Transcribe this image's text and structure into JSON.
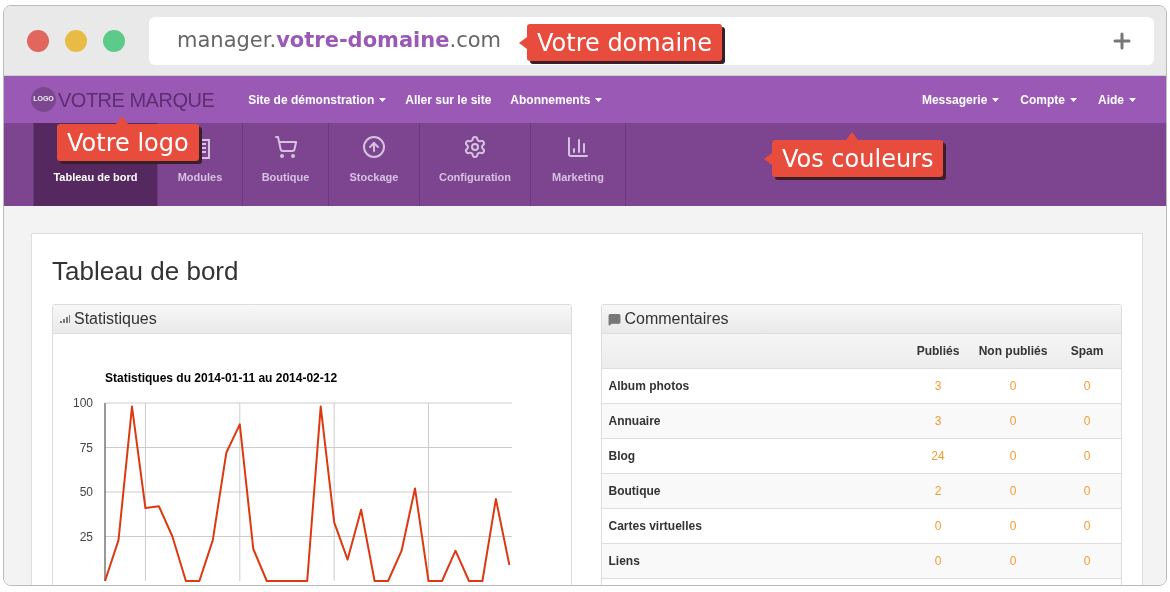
{
  "browser": {
    "url": [
      {
        "text": "manager.",
        "highlight": false
      },
      {
        "text": "votre-domaine",
        "highlight": true
      },
      {
        "text": ".com",
        "highlight": false
      }
    ]
  },
  "navbar": {
    "logo_badge": "LOGO",
    "brand": "VOTRE MARQUE",
    "menus_left": [
      {
        "label": "Site de démonstration",
        "dropdown": true
      },
      {
        "label": "Aller sur le site",
        "dropdown": false
      },
      {
        "label": "Abonnements",
        "dropdown": true
      }
    ],
    "menus_right": [
      {
        "label": "Messagerie",
        "dropdown": true
      },
      {
        "label": "Compte",
        "dropdown": true
      },
      {
        "label": "Aide",
        "dropdown": true
      }
    ]
  },
  "tabs": [
    {
      "label": "Tableau de bord",
      "selected": true
    },
    {
      "label": "Modules",
      "selected": false
    },
    {
      "label": "Boutique",
      "selected": false
    },
    {
      "label": "Stockage",
      "selected": false
    },
    {
      "label": "Configuration",
      "selected": false
    },
    {
      "label": "Marketing",
      "selected": false
    }
  ],
  "page_title": "Tableau de bord",
  "statistics_panel": {
    "title": "Statistiques",
    "chart_data": {
      "type": "line",
      "title": "Statistiques du 2014-01-11 au 2014-02-12",
      "ylim": [
        0,
        100
      ],
      "yticks": [
        25,
        50,
        75,
        100
      ],
      "grid": true,
      "series": [
        {
          "color": "#dc3912",
          "values": [
            0,
            23,
            98,
            41,
            42,
            25,
            0,
            0,
            23,
            72,
            88,
            18,
            0,
            0,
            0,
            0,
            98,
            33,
            12,
            40,
            0,
            0,
            17,
            52,
            0,
            0,
            17,
            0,
            0,
            46,
            9
          ]
        }
      ]
    }
  },
  "comments_panel": {
    "title": "Commentaires",
    "columns": [
      "Publiés",
      "Non publiés",
      "Spam"
    ],
    "rows": [
      {
        "name": "Album photos",
        "values": [
          "3",
          "0",
          "0"
        ]
      },
      {
        "name": "Annuaire",
        "values": [
          "3",
          "0",
          "0"
        ]
      },
      {
        "name": "Blog",
        "values": [
          "24",
          "0",
          "0"
        ]
      },
      {
        "name": "Boutique",
        "values": [
          "2",
          "0",
          "0"
        ]
      },
      {
        "name": "Cartes virtuelles",
        "values": [
          "0",
          "0",
          "0"
        ]
      },
      {
        "name": "Liens",
        "values": [
          "0",
          "0",
          "0"
        ]
      }
    ]
  },
  "callouts": [
    {
      "text": "Votre domaine",
      "pointer_left": true,
      "pointer_up": false
    },
    {
      "text": "Votre logo",
      "pointer_left": false,
      "pointer_up": true
    },
    {
      "text": "Vos couleurs",
      "pointer_left": true,
      "pointer_up": true
    }
  ]
}
